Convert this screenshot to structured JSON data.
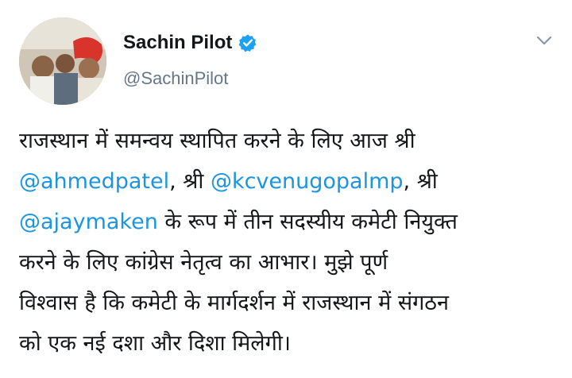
{
  "user": {
    "display_name": "Sachin Pilot",
    "handle": "@SachinPilot",
    "verified": true,
    "verified_color": "#1da1f2"
  },
  "tweet": {
    "segments": {
      "line1": "राजस्थान में समन्वय स्थापित करने के लिए आज श्री",
      "mention1": "@ahmedpatel",
      "after_mention1": ", श्री ",
      "mention2": "@kcvenugopalmp",
      "after_mention2": ", श्री",
      "mention3": "@ajaymaken",
      "after_mention3": " के रूप में तीन सदस्यीय कमेटी नियुक्त",
      "line4": "करने के लिए कांग्रेस नेतृत्व का आभार। मुझे पूर्ण",
      "line5": "विश्वास है कि कमेटी के मार्गदर्शन में राजस्थान में संगठन",
      "line6": "को एक नई दशा और दिशा मिलेगी।"
    },
    "mention_color": "#1b95e0"
  },
  "icons": {
    "verified": "verified-badge-icon",
    "menu": "chevron-down-icon"
  }
}
